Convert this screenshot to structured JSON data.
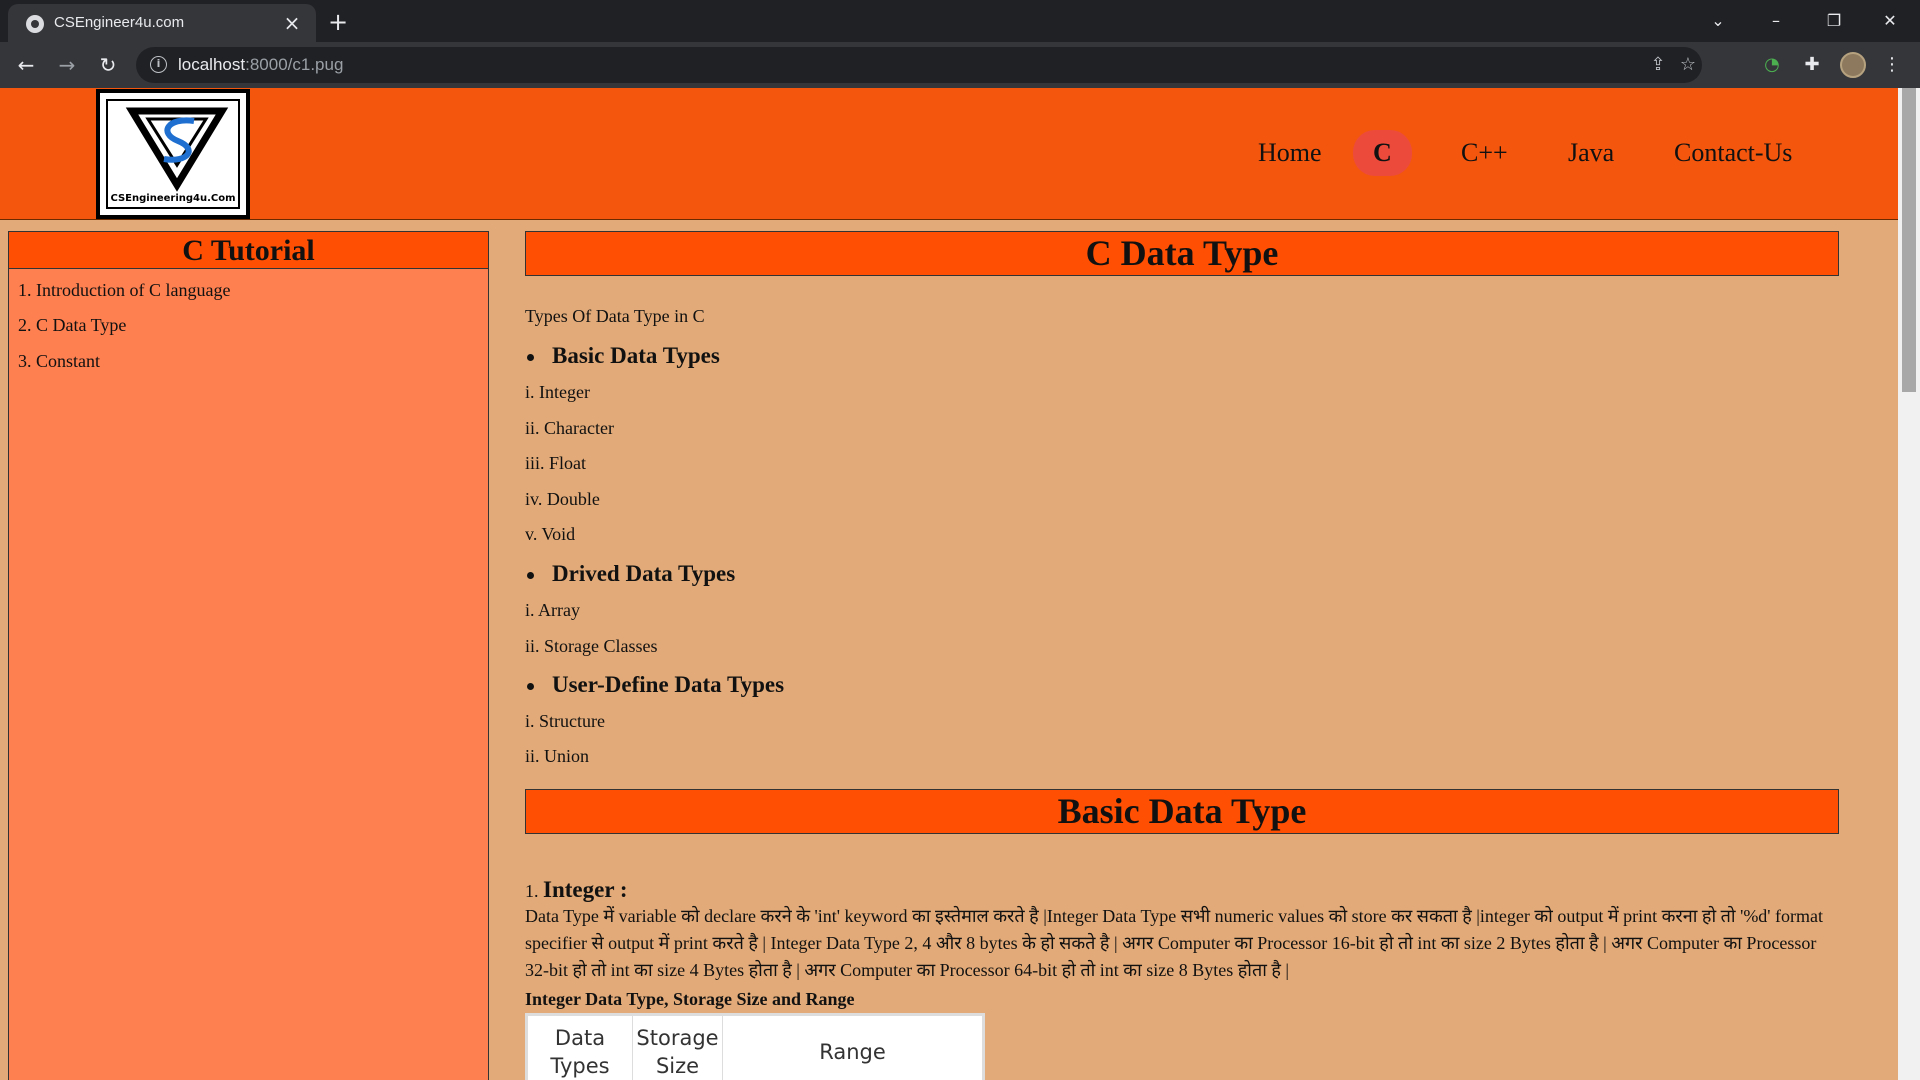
{
  "browser": {
    "tab_title": "CSEngineer4u.com",
    "url_host": "localhost",
    "url_rest": ":8000/c1.pug",
    "icons": [
      "back-icon",
      "forward-icon",
      "reload-icon",
      "info-icon",
      "share-icon",
      "star-icon",
      "extension-icon",
      "puzzle-icon",
      "menu-icon"
    ]
  },
  "site": {
    "logo_text": "CSEngineering4u.Com",
    "nav": [
      {
        "label": "Home",
        "active": false
      },
      {
        "label": "C",
        "active": true
      },
      {
        "label": "C++",
        "active": false
      },
      {
        "label": "Java",
        "active": false
      },
      {
        "label": "Contact-Us",
        "active": false
      }
    ],
    "accent": "#f4560d",
    "banner_color": "#fe4f02",
    "background": "#e2aa78"
  },
  "sidebar": {
    "title": "C Tutorial",
    "links": [
      "1. Introduction of C language",
      "2. C Data Type",
      "3. Constant"
    ]
  },
  "main": {
    "heading": "C Data Type",
    "intro": "Types Of Data Type in C",
    "groups": [
      {
        "title": "Basic Data Types",
        "items": [
          "i. Integer",
          "ii. Character",
          "iii. Float",
          "iv. Double",
          "v. Void"
        ]
      },
      {
        "title": "Drived Data Types",
        "items": [
          "i. Array",
          "ii. Storage Classes"
        ]
      },
      {
        "title": "User-Define Data Types",
        "items": [
          "i. Structure",
          "ii. Union"
        ]
      }
    ],
    "section2_heading": "Basic Data Type",
    "integer_number": "1.",
    "integer_title": "Integer :",
    "integer_para": "Data Type में variable को declare करने के 'int' keyword का इस्तेमाल करते है |Integer Data Type सभी numeric values को store कर सकता है |integer को output में print करना हो तो '%d' format specifier से output में print करते है | Integer Data Type 2, 4 और 8 bytes के हो सकते है | अगर Computer का Processor 16-bit हो तो int का size 2 Bytes होता है | अगर Computer का Processor 32-bit हो तो int का size 4 Bytes होता है | अगर Computer का Processor 64-bit हो तो int का size 8 Bytes होता है |",
    "table_caption": "Integer Data Type, Storage Size and Range",
    "table_headers": [
      "Data Types",
      "Storage Size",
      "Range"
    ]
  }
}
